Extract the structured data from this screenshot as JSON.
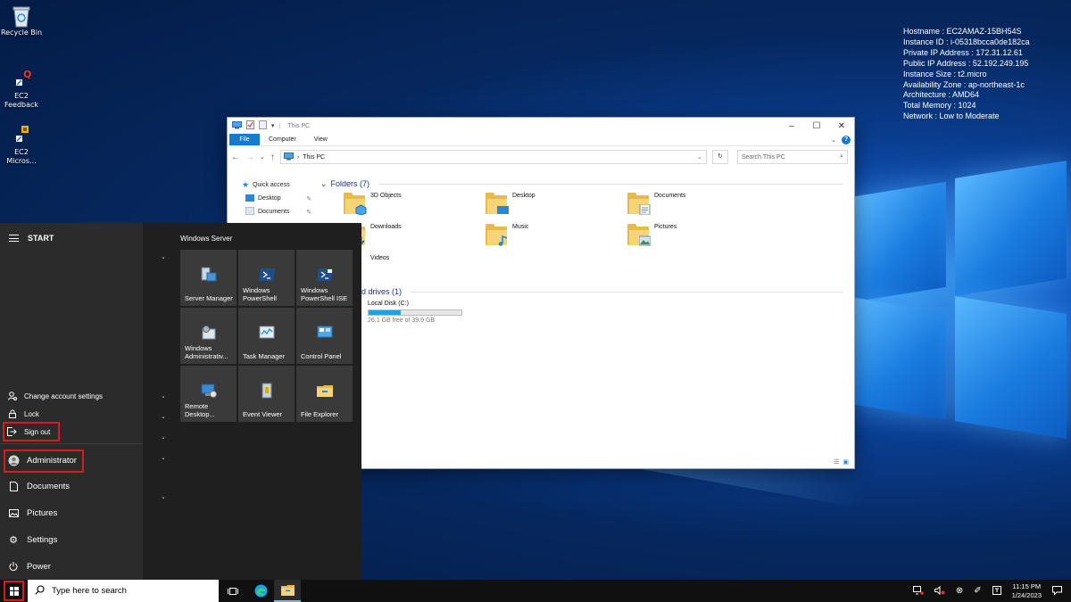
{
  "desktop": {
    "icons": [
      {
        "label": "Recycle Bin"
      },
      {
        "label": "EC2\nFeedback"
      },
      {
        "label": "EC2\nMicros..."
      }
    ],
    "info_lines": [
      "Hostname : EC2AMAZ-15BH54S",
      "Instance ID : i-05318bcca0de182ca",
      "Private IP Address : 172.31.12.61",
      "Public IP Address : 52.192.249.195",
      "Instance Size : t2.micro",
      "Availability Zone : ap-northeast-1c",
      "Architecture : AMD64",
      "Total Memory : 1024",
      "Network : Low to Moderate"
    ]
  },
  "explorer": {
    "title": "This PC",
    "tabs": {
      "file": "File",
      "computer": "Computer",
      "view": "View"
    },
    "address": "This PC",
    "search_placeholder": "Search This PC",
    "nav": {
      "quick_access": "Quick access",
      "desktop": "Desktop",
      "documents": "Documents"
    },
    "folders_header": "Folders (7)",
    "folders": {
      "objects3d": "3D Objects",
      "desktop": "Desktop",
      "documents": "Documents",
      "downloads": "Downloads",
      "music": "Music",
      "pictures": "Pictures",
      "videos": "Videos"
    },
    "drives_header": "and drives (1)",
    "drive": {
      "name": "Local Disk (C:)",
      "free_text": "26.1 GB free of 39.9 GB",
      "used_fraction": 0.346
    }
  },
  "start_menu": {
    "header": "START",
    "group_name": "Windows Server",
    "account_menu": {
      "change_settings": "Change account settings",
      "lock": "Lock",
      "sign_out": "Sign out"
    },
    "user": "Administrator",
    "rail": {
      "documents": "Documents",
      "pictures": "Pictures",
      "settings": "Settings",
      "power": "Power"
    },
    "tiles": {
      "server_manager": "Server Manager",
      "powershell": "Windows PowerShell",
      "powershell_ise": "Windows PowerShell ISE",
      "admin_tools": "Windows Administrativ...",
      "task_manager": "Task Manager",
      "control_panel": "Control Panel",
      "remote_desktop": "Remote Desktop...",
      "event_viewer": "Event Viewer",
      "file_explorer": "File Explorer"
    }
  },
  "taskbar": {
    "search_placeholder": "Type here to search",
    "time": "11:15 PM",
    "date": "1/24/2023"
  }
}
